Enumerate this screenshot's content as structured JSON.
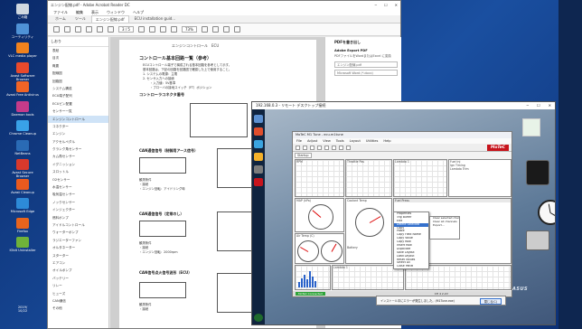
{
  "desktop": {
    "icons": [
      {
        "label": "ごみ箱",
        "color": "#d0d8e0"
      },
      {
        "label": "ユーティリティ",
        "color": "#4f92d6"
      },
      {
        "label": "VLC media player",
        "color": "#f0821e"
      },
      {
        "label": "Avast Software Browser",
        "color": "#e84a2c"
      },
      {
        "label": "Avast Free Antivirus",
        "color": "#f06426"
      },
      {
        "label": "Daemon tools",
        "color": "#c43b8a"
      },
      {
        "label": "Chrome Cleanup",
        "color": "#39a1e8"
      },
      {
        "label": "NetBeans",
        "color": "#2a6bb5"
      },
      {
        "label": "Avast Secure Browser",
        "color": "#d8392c"
      },
      {
        "label": "Avast Cleanup",
        "color": "#ea5a1e"
      },
      {
        "label": "Microsoft Edge",
        "color": "#2d8ad8"
      },
      {
        "label": "Firefox",
        "color": "#e8641c"
      },
      {
        "label": "IObit Uninstaller",
        "color": "#6fb23a"
      }
    ],
    "bottom_text": "2019/\n10/22"
  },
  "pdf": {
    "window_title": "エンジン配線.pdf - Adobe Acrobat Reader DC",
    "menu": [
      "ファイル",
      "編集",
      "表示",
      "ウィンドウ",
      "ヘルプ"
    ],
    "tabs": [
      "ホーム",
      "ツール",
      "エンジン配線.pdf",
      "ECU installation guid..."
    ],
    "toolbar": {
      "page": "3 / 5",
      "zoom": "73%"
    },
    "bookmarks_header": "しおり",
    "bookmarks": [
      "表紙",
      "目次",
      "概要",
      "配線図",
      "回路図",
      "システム構成",
      "ECU端子配列",
      "ECUピン配置",
      "センサー一覧",
      "エンジンコントロール",
      "コネクター",
      "エンジン",
      "アクセルペダル",
      "クランク角センサー",
      "カム角センサー",
      "イグニッション",
      "スロットル",
      "O2センサー",
      "水温センサー",
      "吸気温センサー",
      "ノックセンサー",
      "インジェクター",
      "燃料ポンプ",
      "アイドルコントロール",
      "ウォーターポンプ",
      "ラジエーターファン",
      "オルタネーター",
      "スターター",
      "エアコン",
      "オイルポンプ",
      "バッテリー",
      "リレー",
      "ヒューズ",
      "CAN通信",
      "その他"
    ],
    "selected_bookmark_index": 9,
    "page": {
      "header": "エンジンコントロール　ECU",
      "section1": "コントロール基本回路一覧（参考）",
      "lines1": [
        "ECUコントロール端子で構成される基本回路を参考として示す。",
        "基本回路は、下記の回路を回路図で確認した上で使用すること。",
        "1. システムの電源：主電",
        "2. センサ入力への接続",
        "・入力値：5V基準",
        "・ブローバの接地スイッチ（FT）ポジション"
      ],
      "section2": "コントローラコネクタ番号",
      "section3": "CAN通信信号（制御用アース信号）",
      "section4": "CAN通信信号（定常のし）",
      "section5": "CAN信号点火信号波形（ECU）",
      "notes": [
        "観測条件",
        "・接続",
        "・エンジン回転：アイドリング時",
        "・エンジン回転：2000rpm"
      ]
    },
    "right_panel": {
      "title": "PDFを書き出し",
      "subtitle": "Adobe Export PDF",
      "desc": "PDFファイルをWordまたはExcel に変換",
      "file": "エンジン配線.pdf",
      "format": "Microsoft Word (*.docx)"
    }
  },
  "vm": {
    "title": "192.168.0.3 - リモート デスクトップ接続",
    "brand": "ASUS",
    "motec": {
      "title": "MoTeC M1 Tune - ecu.m1tune",
      "menu": [
        "File",
        "Adjust",
        "View",
        "Tools",
        "Layout",
        "Utilities",
        "Help"
      ],
      "logo": "MoTeC",
      "tab": "Startup",
      "panels": {
        "rpm": "RPM",
        "throttle": "Throttle Pos",
        "lambda": "Lambda 1",
        "map": "MAP (kPa)",
        "coolant": "Coolant Temp",
        "air_temp": "Air Temp (C)",
        "battery": "Battery",
        "fuel_inj": "Fuel Inj",
        "ign_timing": "Ign Timing",
        "lambda_trim": "Lambda Trim",
        "fuel_press": "Fuel Press"
      },
      "context_menu": [
        "Properties",
        "Trig Buffer",
        "Edit",
        "Delete Selected",
        "Copy",
        "Paste",
        "Copy Field Name",
        "Copy Value",
        "Copy Row",
        "Insert Row",
        "Duplicate",
        "Save Layout",
        "Load Layout",
        "Reset Values",
        "Select All",
        "Close Panel"
      ],
      "context_selected": 3,
      "submenu": [
        "Clear selected channels",
        "Clear all channels",
        "Export..."
      ],
      "status": "MoTeC Connected",
      "status_right": "CH 4    2.2V"
    },
    "notice": {
      "text": "インストール中にエラーが発生しました。(M1Tune.exe)",
      "button": "閉じる(C)"
    }
  }
}
